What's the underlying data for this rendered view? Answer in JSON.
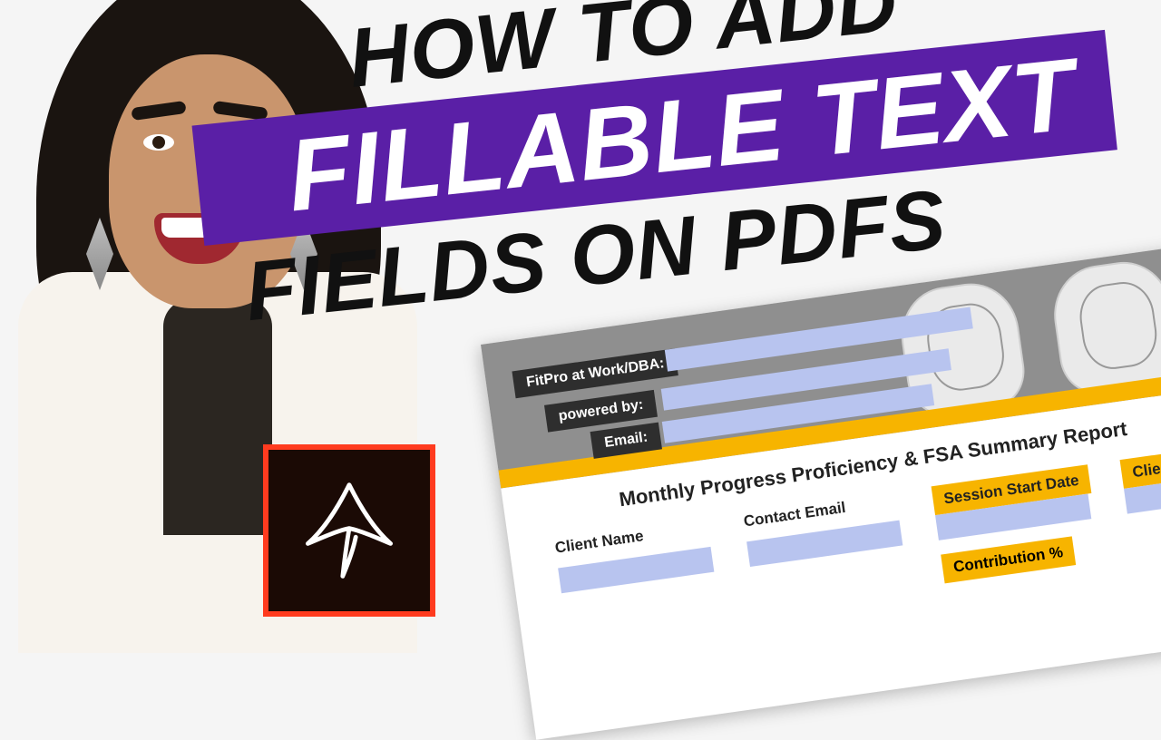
{
  "headline": {
    "line1": "HOW TO ADD",
    "line2": "FILLABLE TEXT",
    "line3": "FIELDS ON PDFS"
  },
  "icon": {
    "name": "adobe-acrobat"
  },
  "form": {
    "header_labels": {
      "dba": "FitPro at Work/DBA:",
      "powered": "powered by:",
      "email": "Email:"
    },
    "report_title": "Monthly Progress Proficiency & FSA Summary Report",
    "columns": {
      "client_name": "Client Name",
      "contact_email": "Contact Email",
      "session_start": "Session Start Date",
      "client_id": "Client ID",
      "contribution": "Contribution %"
    }
  }
}
